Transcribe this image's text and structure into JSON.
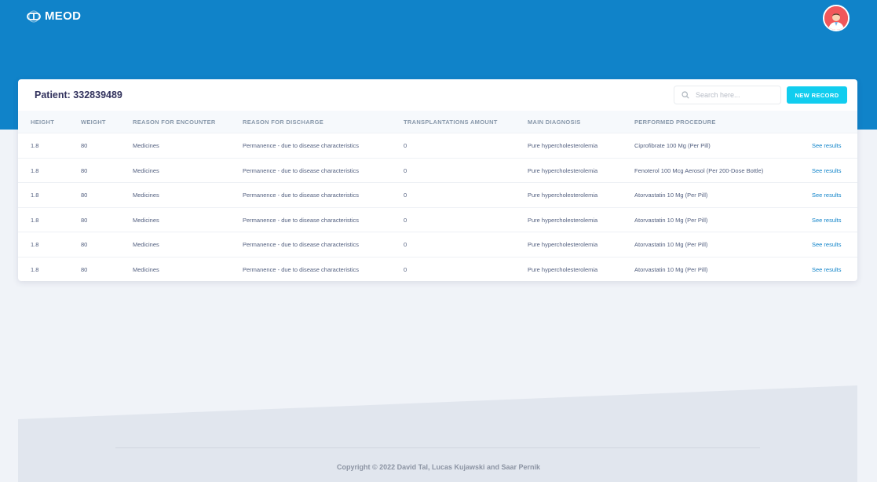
{
  "brand": {
    "name": "MEOD"
  },
  "header": {
    "avatar_icon": "doctor-avatar"
  },
  "card": {
    "title": "Patient: 332839489",
    "search_placeholder": "Search here...",
    "new_record_label": "NEW RECORD"
  },
  "table": {
    "columns": [
      "HEIGHT",
      "WEIGHT",
      "REASON FOR ENCOUNTER",
      "REASON FOR DISCHARGE",
      "TRANSPLANTATIONS AMOUNT",
      "MAIN DIAGNOSIS",
      "PERFORMED PROCEDURE"
    ],
    "rows": [
      {
        "height": "1.8",
        "weight": "80",
        "encounter": "Medicines",
        "discharge": "Permanence - due to disease characteristics",
        "transplants": "0",
        "diagnosis": "Pure hypercholesterolemia",
        "procedure": "Ciprofibrate 100 Mg (Per Pill)",
        "action": "See results"
      },
      {
        "height": "1.8",
        "weight": "80",
        "encounter": "Medicines",
        "discharge": "Permanence - due to disease characteristics",
        "transplants": "0",
        "diagnosis": "Pure hypercholesterolemia",
        "procedure": "Fenoterol 100 Mcg Aerosol (Per 200-Dose Bottle)",
        "action": "See results"
      },
      {
        "height": "1.8",
        "weight": "80",
        "encounter": "Medicines",
        "discharge": "Permanence - due to disease characteristics",
        "transplants": "0",
        "diagnosis": "Pure hypercholesterolemia",
        "procedure": "Atorvastatin 10 Mg (Per Pill)",
        "action": "See results"
      },
      {
        "height": "1.8",
        "weight": "80",
        "encounter": "Medicines",
        "discharge": "Permanence - due to disease characteristics",
        "transplants": "0",
        "diagnosis": "Pure hypercholesterolemia",
        "procedure": "Atorvastatin 10 Mg (Per Pill)",
        "action": "See results"
      },
      {
        "height": "1.8",
        "weight": "80",
        "encounter": "Medicines",
        "discharge": "Permanence - due to disease characteristics",
        "transplants": "0",
        "diagnosis": "Pure hypercholesterolemia",
        "procedure": "Atorvastatin 10 Mg (Per Pill)",
        "action": "See results"
      },
      {
        "height": "1.8",
        "weight": "80",
        "encounter": "Medicines",
        "discharge": "Permanence - due to disease characteristics",
        "transplants": "0",
        "diagnosis": "Pure hypercholesterolemia",
        "procedure": "Atorvastatin 10 Mg (Per Pill)",
        "action": "See results"
      }
    ]
  },
  "footer": {
    "copyright": "Copyright © 2022 David Tal, Lucas Kujawski and Saar Pernik"
  },
  "colors": {
    "header_bg": "#1083c9",
    "accent_button": "#11cdef",
    "link": "#1083c9",
    "page_bg": "#f0f3f8"
  }
}
